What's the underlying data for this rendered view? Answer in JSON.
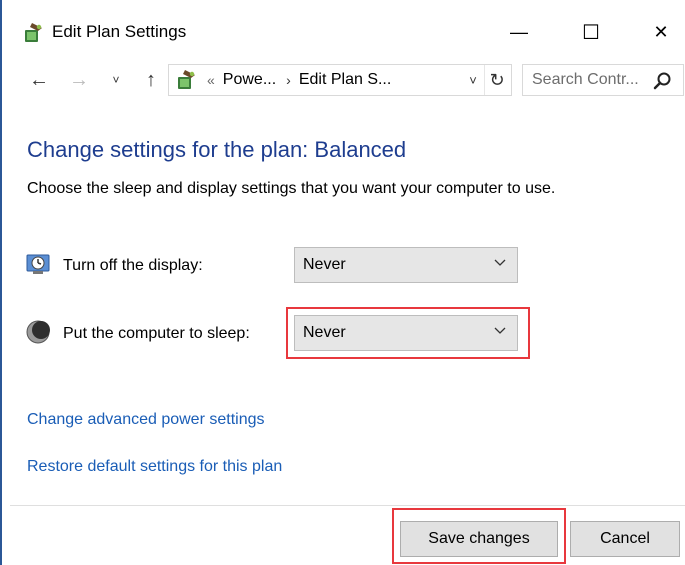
{
  "window": {
    "title": "Edit Plan Settings",
    "min_glyph": "—",
    "max_glyph": "☐",
    "close_glyph": "✕"
  },
  "nav": {
    "back_glyph": "←",
    "forward_glyph": "→",
    "recent_glyph": "˅",
    "up_glyph": "↑",
    "breadcrumb_chevron": "«",
    "breadcrumb": [
      "Powe...",
      "Edit Plan S..."
    ],
    "breadcrumb_separator": "›",
    "dropdown_glyph": "˅",
    "refresh_glyph": "↻",
    "search_placeholder": "Search Contr..."
  },
  "content": {
    "heading": "Change settings for the plan: Balanced",
    "subheading": "Choose the sleep and display settings that you want your computer to use.",
    "display_label": "Turn off the display:",
    "display_value": "Never",
    "sleep_label": "Put the computer to sleep:",
    "sleep_value": "Never",
    "link_advanced": "Change advanced power settings",
    "link_restore": "Restore default settings for this plan"
  },
  "footer": {
    "save_label": "Save changes",
    "cancel_label": "Cancel"
  },
  "colors": {
    "heading": "#1e3d8f",
    "link": "#1a5db6",
    "highlight": "#e8383d"
  },
  "icons": {
    "app": "power-options-icon",
    "display": "monitor-clock-icon",
    "sleep": "moon-icon",
    "search": "search-icon",
    "chevron": "chevron-down-icon"
  }
}
